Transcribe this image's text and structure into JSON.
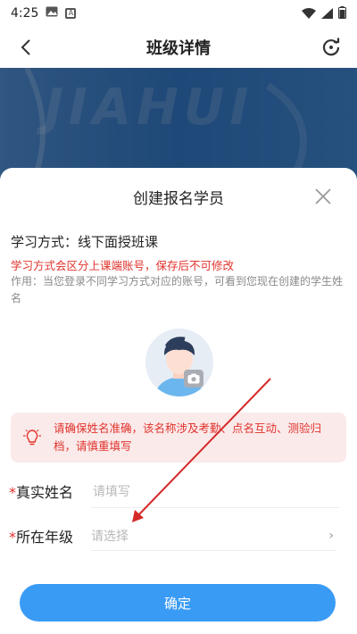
{
  "status_bar": {
    "time": "4:25",
    "notification_badge": "A"
  },
  "nav": {
    "title": "班级详情"
  },
  "banner": {
    "watermark": "JIAHUI"
  },
  "dialog": {
    "title": "创建报名学员",
    "study_method_label": "学习方式：",
    "study_method_value": "线下面授班课",
    "warning": "学习方式会区分上课端账号，保存后不可修改",
    "note": "作用：当您登录不同学习方式对应的账号，可看到您现在创建的学生姓名",
    "tip": "请确保姓名准确，该名称涉及考勤、点名互动、测验归档，请慎重填写",
    "fields": [
      {
        "required_mark": "*",
        "label": "真实姓名",
        "placeholder": "请填写"
      },
      {
        "required_mark": "*",
        "label": "所在年级",
        "placeholder": "请选择",
        "chevron": "›"
      }
    ],
    "confirm_label": "确定"
  },
  "colors": {
    "accent": "#3a9bf5",
    "warning": "#e0332c",
    "tip_bg": "#fbeaea",
    "annotation_arrow": "#d42a2a"
  }
}
